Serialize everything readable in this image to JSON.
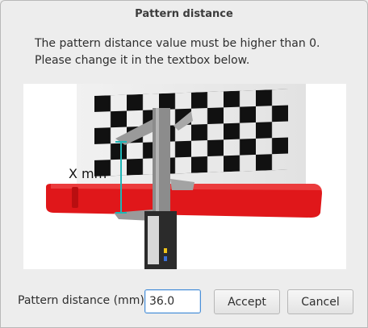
{
  "dialog": {
    "title": "Pattern distance",
    "message": "The pattern distance value must be higher than 0. Please change it in the textbox below."
  },
  "illustration": {
    "label": "X mm",
    "colors": {
      "pattern": "#000000",
      "platform": "#e0171a",
      "measure_line": "#1fb6b6",
      "caliper": "#9a9a9a",
      "caliper_body": "#2b2b2b"
    }
  },
  "form": {
    "label": "Pattern distance (mm)",
    "value": "36.0",
    "accept_label": "Accept",
    "cancel_label": "Cancel"
  }
}
